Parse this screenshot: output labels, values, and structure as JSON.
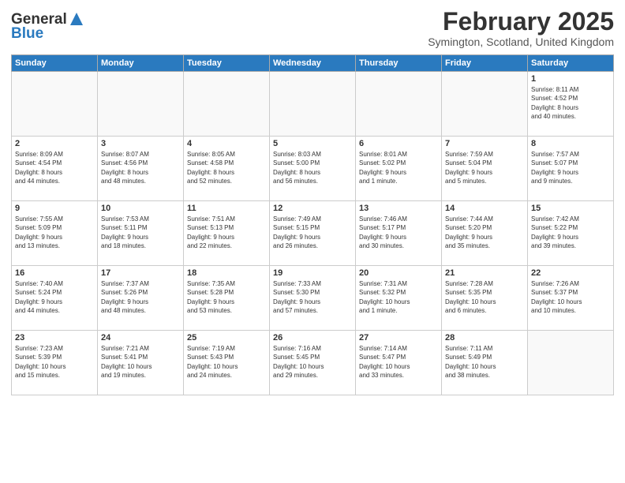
{
  "header": {
    "logo_line1": "General",
    "logo_line2": "Blue",
    "month_title": "February 2025",
    "location": "Symington, Scotland, United Kingdom"
  },
  "weekdays": [
    "Sunday",
    "Monday",
    "Tuesday",
    "Wednesday",
    "Thursday",
    "Friday",
    "Saturday"
  ],
  "weeks": [
    [
      {
        "day": "",
        "info": ""
      },
      {
        "day": "",
        "info": ""
      },
      {
        "day": "",
        "info": ""
      },
      {
        "day": "",
        "info": ""
      },
      {
        "day": "",
        "info": ""
      },
      {
        "day": "",
        "info": ""
      },
      {
        "day": "1",
        "info": "Sunrise: 8:11 AM\nSunset: 4:52 PM\nDaylight: 8 hours\nand 40 minutes."
      }
    ],
    [
      {
        "day": "2",
        "info": "Sunrise: 8:09 AM\nSunset: 4:54 PM\nDaylight: 8 hours\nand 44 minutes."
      },
      {
        "day": "3",
        "info": "Sunrise: 8:07 AM\nSunset: 4:56 PM\nDaylight: 8 hours\nand 48 minutes."
      },
      {
        "day": "4",
        "info": "Sunrise: 8:05 AM\nSunset: 4:58 PM\nDaylight: 8 hours\nand 52 minutes."
      },
      {
        "day": "5",
        "info": "Sunrise: 8:03 AM\nSunset: 5:00 PM\nDaylight: 8 hours\nand 56 minutes."
      },
      {
        "day": "6",
        "info": "Sunrise: 8:01 AM\nSunset: 5:02 PM\nDaylight: 9 hours\nand 1 minute."
      },
      {
        "day": "7",
        "info": "Sunrise: 7:59 AM\nSunset: 5:04 PM\nDaylight: 9 hours\nand 5 minutes."
      },
      {
        "day": "8",
        "info": "Sunrise: 7:57 AM\nSunset: 5:07 PM\nDaylight: 9 hours\nand 9 minutes."
      }
    ],
    [
      {
        "day": "9",
        "info": "Sunrise: 7:55 AM\nSunset: 5:09 PM\nDaylight: 9 hours\nand 13 minutes."
      },
      {
        "day": "10",
        "info": "Sunrise: 7:53 AM\nSunset: 5:11 PM\nDaylight: 9 hours\nand 18 minutes."
      },
      {
        "day": "11",
        "info": "Sunrise: 7:51 AM\nSunset: 5:13 PM\nDaylight: 9 hours\nand 22 minutes."
      },
      {
        "day": "12",
        "info": "Sunrise: 7:49 AM\nSunset: 5:15 PM\nDaylight: 9 hours\nand 26 minutes."
      },
      {
        "day": "13",
        "info": "Sunrise: 7:46 AM\nSunset: 5:17 PM\nDaylight: 9 hours\nand 30 minutes."
      },
      {
        "day": "14",
        "info": "Sunrise: 7:44 AM\nSunset: 5:20 PM\nDaylight: 9 hours\nand 35 minutes."
      },
      {
        "day": "15",
        "info": "Sunrise: 7:42 AM\nSunset: 5:22 PM\nDaylight: 9 hours\nand 39 minutes."
      }
    ],
    [
      {
        "day": "16",
        "info": "Sunrise: 7:40 AM\nSunset: 5:24 PM\nDaylight: 9 hours\nand 44 minutes."
      },
      {
        "day": "17",
        "info": "Sunrise: 7:37 AM\nSunset: 5:26 PM\nDaylight: 9 hours\nand 48 minutes."
      },
      {
        "day": "18",
        "info": "Sunrise: 7:35 AM\nSunset: 5:28 PM\nDaylight: 9 hours\nand 53 minutes."
      },
      {
        "day": "19",
        "info": "Sunrise: 7:33 AM\nSunset: 5:30 PM\nDaylight: 9 hours\nand 57 minutes."
      },
      {
        "day": "20",
        "info": "Sunrise: 7:31 AM\nSunset: 5:32 PM\nDaylight: 10 hours\nand 1 minute."
      },
      {
        "day": "21",
        "info": "Sunrise: 7:28 AM\nSunset: 5:35 PM\nDaylight: 10 hours\nand 6 minutes."
      },
      {
        "day": "22",
        "info": "Sunrise: 7:26 AM\nSunset: 5:37 PM\nDaylight: 10 hours\nand 10 minutes."
      }
    ],
    [
      {
        "day": "23",
        "info": "Sunrise: 7:23 AM\nSunset: 5:39 PM\nDaylight: 10 hours\nand 15 minutes."
      },
      {
        "day": "24",
        "info": "Sunrise: 7:21 AM\nSunset: 5:41 PM\nDaylight: 10 hours\nand 19 minutes."
      },
      {
        "day": "25",
        "info": "Sunrise: 7:19 AM\nSunset: 5:43 PM\nDaylight: 10 hours\nand 24 minutes."
      },
      {
        "day": "26",
        "info": "Sunrise: 7:16 AM\nSunset: 5:45 PM\nDaylight: 10 hours\nand 29 minutes."
      },
      {
        "day": "27",
        "info": "Sunrise: 7:14 AM\nSunset: 5:47 PM\nDaylight: 10 hours\nand 33 minutes."
      },
      {
        "day": "28",
        "info": "Sunrise: 7:11 AM\nSunset: 5:49 PM\nDaylight: 10 hours\nand 38 minutes."
      },
      {
        "day": "",
        "info": ""
      }
    ]
  ]
}
